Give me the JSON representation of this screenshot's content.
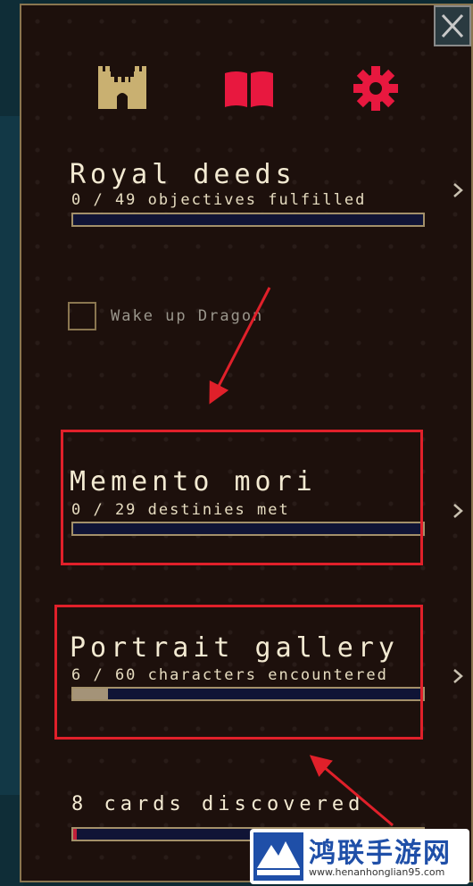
{
  "tabs": [
    {
      "icon": "castle-icon",
      "color": "#c9b071"
    },
    {
      "icon": "book-icon",
      "color": "#e8183f"
    },
    {
      "icon": "gear-icon",
      "color": "#e8183f"
    }
  ],
  "sections": {
    "royal_deeds": {
      "title": "Royal deeds",
      "subtitle": "0 / 49 objectives fulfilled",
      "progress": 0
    },
    "memento_mori": {
      "title": "Memento mori",
      "subtitle": "0 / 29 destinies met",
      "progress": 0
    },
    "portrait_gallery": {
      "title": "Portrait gallery",
      "subtitle": "6 / 60 characters encountered",
      "progress": 0.1
    },
    "cards": {
      "title": "8 cards discovered",
      "progress": 0.01
    }
  },
  "objective": {
    "label": "Wake up Dragon",
    "checked": false
  },
  "watermark": {
    "name": "鸿联手游网",
    "url": "www.henanhonglian95.com"
  },
  "colors": {
    "annotation": "#e0202a",
    "panel_bg": "#1d100c",
    "text": "#f3ead2"
  }
}
